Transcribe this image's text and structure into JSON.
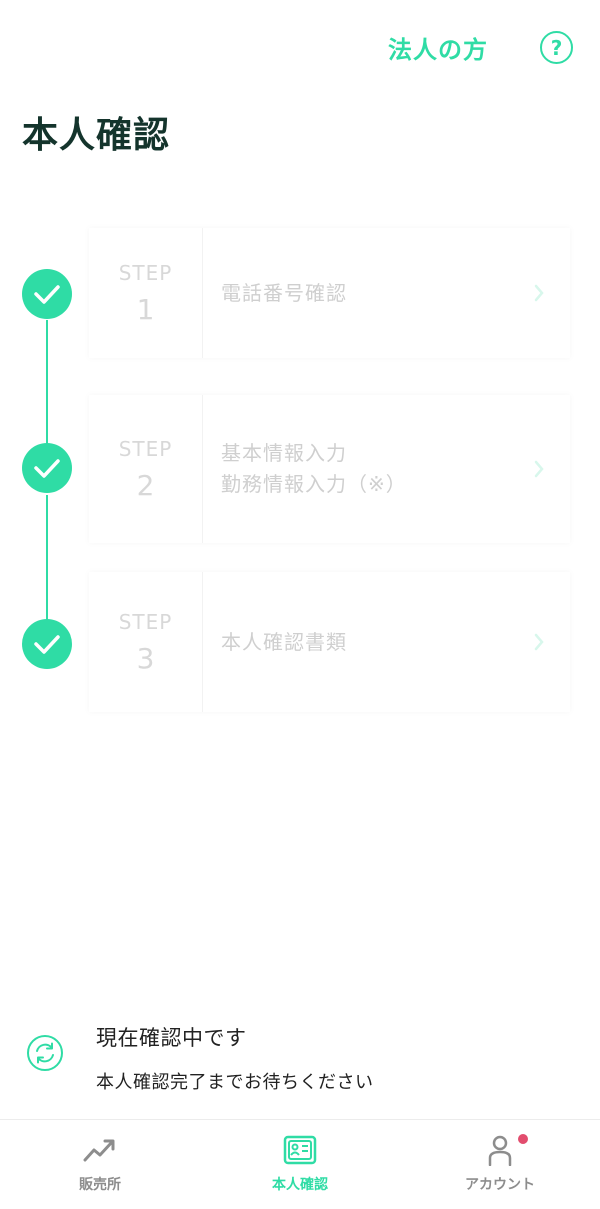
{
  "header": {
    "corporate_link": "法人の方",
    "help_label": "?"
  },
  "page_title": "本人確認",
  "steps": [
    {
      "step_word": "STEP",
      "number": "1",
      "lines": [
        "電話番号確認"
      ],
      "completed": true
    },
    {
      "step_word": "STEP",
      "number": "2",
      "lines": [
        "基本情報入力",
        "勤務情報入力（※）"
      ],
      "completed": true
    },
    {
      "step_word": "STEP",
      "number": "3",
      "lines": [
        "本人確認書類"
      ],
      "completed": true
    }
  ],
  "status": {
    "icon": "refresh-icon",
    "title": "現在確認中です",
    "subtitle": "本人確認完了までお待ちください"
  },
  "bottom_nav": {
    "items": [
      {
        "label": "販売所",
        "icon": "trend-up-icon",
        "active": false
      },
      {
        "label": "本人確認",
        "icon": "id-card-icon",
        "active": true
      },
      {
        "label": "アカウント",
        "icon": "person-icon",
        "active": false,
        "badge": true
      }
    ]
  },
  "colors": {
    "accent": "#2fdca5",
    "title": "#14342c",
    "disabled_text": "#cfcfcf",
    "badge": "#e24d6e"
  }
}
